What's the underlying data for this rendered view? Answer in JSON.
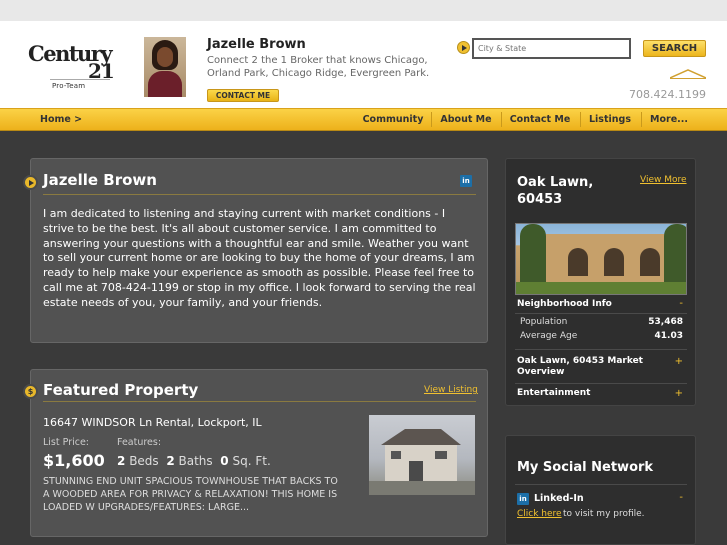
{
  "brand": {
    "logo_text": "Century",
    "logo_number": "21",
    "office": "Pro-Team"
  },
  "agent": {
    "name": "Jazelle Brown",
    "tagline": "Connect 2 the 1 Broker that knows Chicago, Orland Park, Chicago Ridge, Evergreen Park.",
    "contact_label": "CONTACT ME",
    "phone": "708.424.1199"
  },
  "search": {
    "placeholder": "City & State",
    "button_label": "SEARCH"
  },
  "nav": {
    "home": "Home >",
    "items": [
      "Community",
      "About Me",
      "Contact Me",
      "Listings",
      "More..."
    ]
  },
  "bio": {
    "title": "Jazelle Brown",
    "linkedin": "in",
    "text": "I am dedicated to listening and staying current with market conditions - I strive to be the best.  It's all about customer service.  I am committed to answering your questions with a thoughtful ear and smile.  Weather you want to sell your current home or are looking to buy the home of your dreams, I am ready to help make your experience as smooth as possible.  Please feel free to call me at 708-424-1199 or stop in my office.  I look forward to serving the real estate needs of you, your family, and your friends."
  },
  "featured": {
    "title": "Featured Property",
    "view_label": "View Listing",
    "address": "16647 WINDSOR Ln Rental, Lockport, IL",
    "list_price_label": "List Price:",
    "features_label": "Features:",
    "price": "$1,600",
    "beds": "2",
    "beds_label": "Beds",
    "baths": "2",
    "baths_label": "Baths",
    "sqft": "0",
    "sqft_label": "Sq. Ft.",
    "description": "STUNNING END UNIT SPACIOUS TOWNHOUSE THAT BACKS TO A WOODED AREA FOR PRIVACY & RELAXATION! THIS HOME IS LOADED W UPGRADES/FEATURES: LARGE..."
  },
  "community": {
    "title": "Oak Lawn, 60453",
    "view_more": "View More",
    "neighborhood_label": "Neighborhood Info",
    "neighborhood_toggle": "-",
    "stats": [
      {
        "label": "Population",
        "value": "53,468"
      },
      {
        "label": "Average Age",
        "value": "41.03"
      }
    ],
    "market_label": "Oak Lawn, 60453 Market Overview",
    "market_toggle": "+",
    "entertainment_label": "Entertainment",
    "entertainment_toggle": "+"
  },
  "social": {
    "title": "My Social Network",
    "linkedin_label": "Linked-In",
    "linkedin_toggle": "-",
    "link_text": "Click here",
    "link_tail": "to visit my profile."
  },
  "icons": [
    "play-bullet-icon",
    "dollar-bullet-icon",
    "linkedin-icon",
    "roof-icon",
    "search-arrow-icon"
  ],
  "colors": {
    "accent": "#f0c030",
    "nav_bg": "#f5c22f",
    "page_bg": "#3a3a3a",
    "panel_bg": "#525252",
    "side_bg": "#2e2e2e"
  }
}
